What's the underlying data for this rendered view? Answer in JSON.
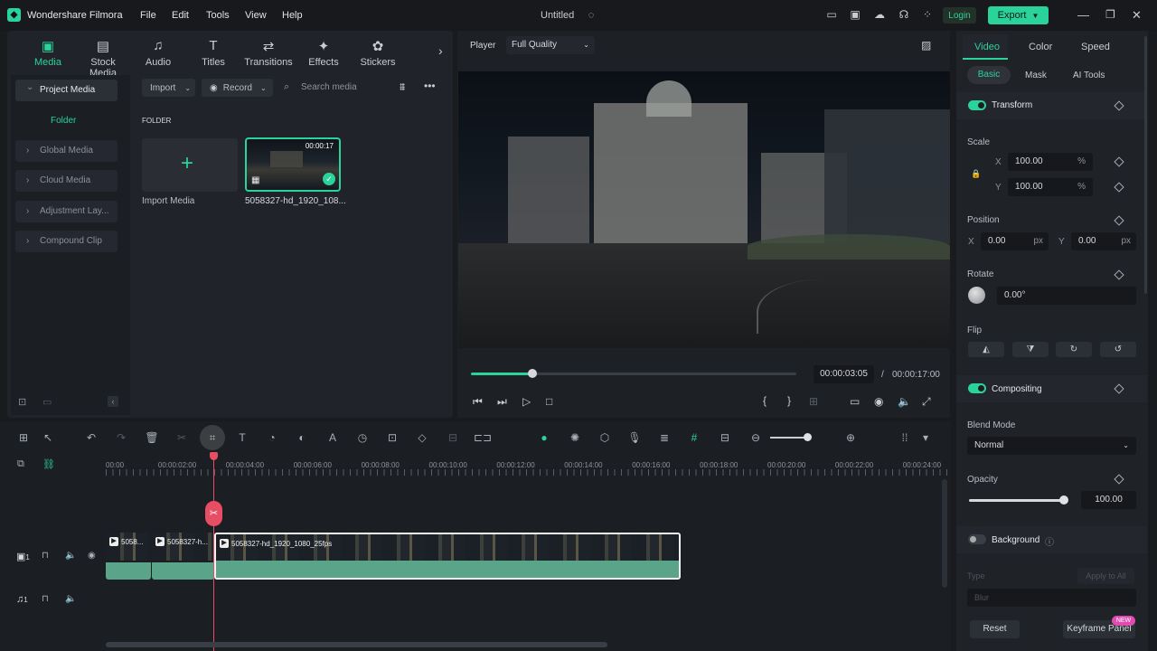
{
  "app": {
    "name": "Wondershare Filmora",
    "project_title": "Untitled",
    "login_label": "Login",
    "export_label": "Export",
    "menu": [
      "File",
      "Edit",
      "Tools",
      "View",
      "Help"
    ]
  },
  "media_tabs": [
    {
      "label": "Media",
      "icon": "media-icon",
      "active": true
    },
    {
      "label": "Stock Media",
      "icon": "stock-media-icon"
    },
    {
      "label": "Audio",
      "icon": "audio-icon"
    },
    {
      "label": "Titles",
      "icon": "titles-icon"
    },
    {
      "label": "Transitions",
      "icon": "transitions-icon"
    },
    {
      "label": "Effects",
      "icon": "effects-icon"
    },
    {
      "label": "Stickers",
      "icon": "stickers-icon"
    }
  ],
  "sidebar": {
    "project_media": "Project Media",
    "folder": "Folder",
    "items": [
      "Global Media",
      "Cloud Media",
      "Adjustment Lay...",
      "Compound Clip"
    ]
  },
  "media_toolbar": {
    "import": "Import",
    "record": "Record",
    "search_placeholder": "Search media"
  },
  "media_area": {
    "folder_header": "FOLDER",
    "import_label": "Import Media",
    "clip_name": "5058327-hd_1920_108...",
    "clip_duration": "00:00:17"
  },
  "player": {
    "label": "Player",
    "quality": "Full Quality",
    "current_time": "00:00:03:05",
    "separator": "/",
    "total_time": "00:00:17:00",
    "progress": 0.19
  },
  "properties": {
    "tabs": [
      "Video",
      "Color",
      "Speed"
    ],
    "subtabs": [
      "Basic",
      "Mask",
      "AI Tools"
    ],
    "transform": "Transform",
    "scale": "Scale",
    "scale_x": "100.00",
    "scale_y": "100.00",
    "percent": "%",
    "x_label": "X",
    "y_label": "Y",
    "position": "Position",
    "pos_x": "0.00",
    "pos_y": "0.00",
    "px": "px",
    "rotate": "Rotate",
    "rotate_value": "0.00°",
    "flip": "Flip",
    "compositing": "Compositing",
    "blend_mode": "Blend Mode",
    "blend_value": "Normal",
    "opacity": "Opacity",
    "opacity_value": "100.00",
    "opacity_level": 1.0,
    "background": "Background",
    "type": "Type",
    "apply_all": "Apply to All",
    "blur": "Blur",
    "reset": "Reset",
    "keyframe_panel": "Keyframe Panel",
    "new_badge": "NEW"
  },
  "timeline": {
    "ticks": [
      "00:00",
      "00:00:02:00",
      "00:00:04:00",
      "00:00:06:00",
      "00:00:08:00",
      "00:00:10:00",
      "00:00:12:00",
      "00:00:14:00",
      "00:00:16:00",
      "00:00:18:00",
      "00:00:20:00",
      "00:00:22:00",
      "00:00:24:00"
    ],
    "clip1": "5058...",
    "clip2": "5058327-h...",
    "clip3": "5058327-hd_1920_1080_25fps",
    "video_track": "1",
    "audio_track": "1"
  },
  "colors": {
    "accent": "#2ad39a",
    "playhead": "#e84e63",
    "panel": "#202329"
  }
}
